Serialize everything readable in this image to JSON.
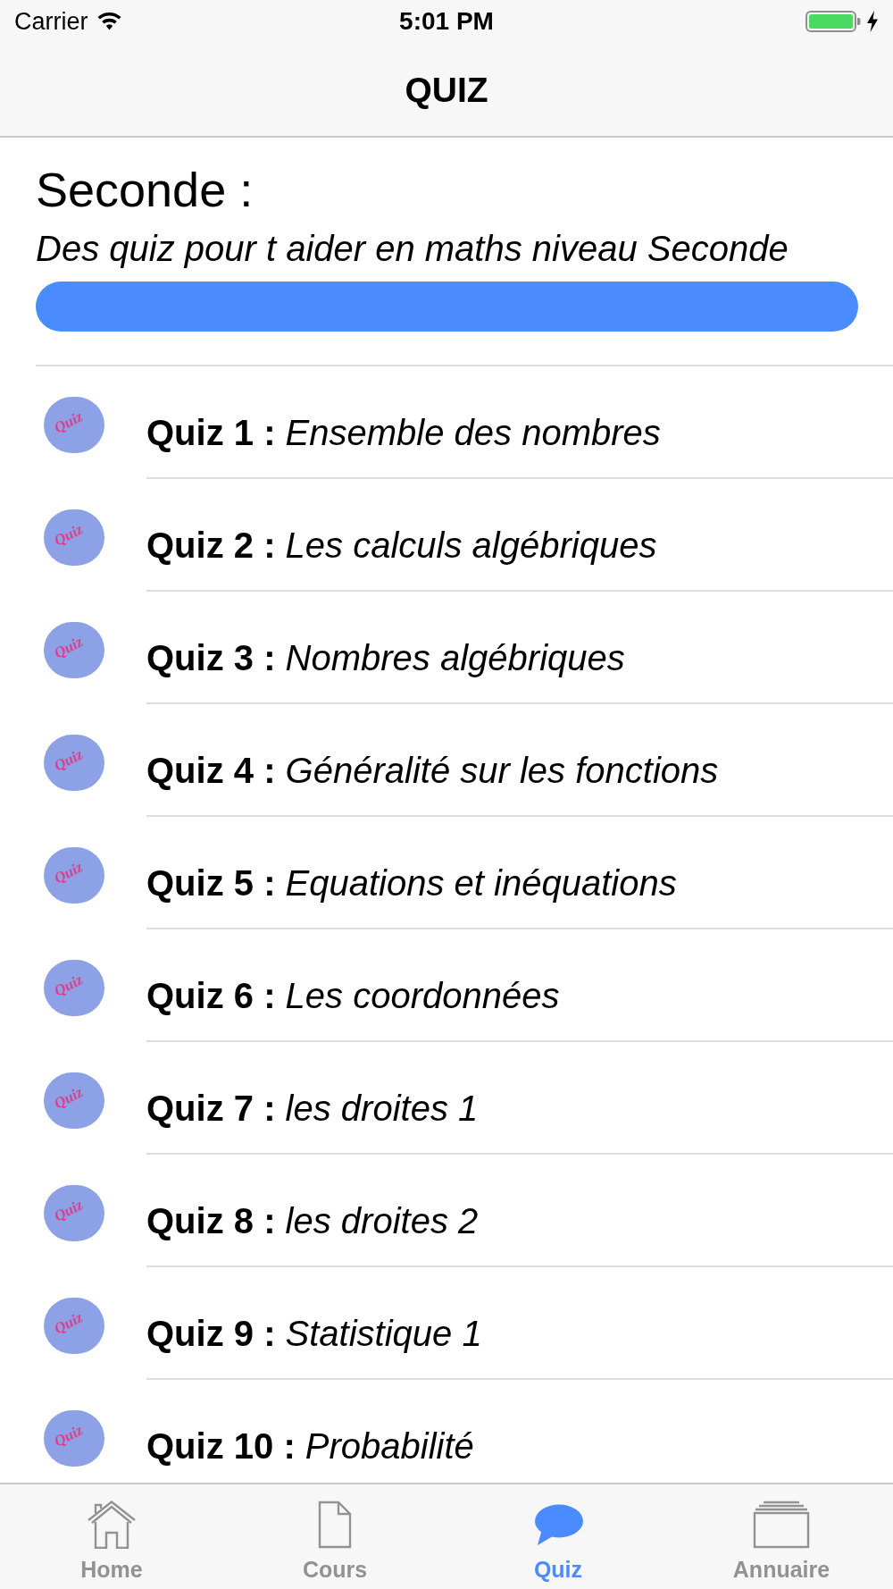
{
  "status_bar": {
    "carrier": "Carrier",
    "time": "5:01 PM"
  },
  "nav_bar": {
    "title": "QUIZ"
  },
  "header": {
    "title": "Seconde :",
    "subtitle": "Des quiz pour t aider en maths niveau Seconde"
  },
  "quizzes": [
    {
      "logo_text": "Quiz",
      "label": "Quiz 1 :",
      "topic": "Ensemble des nombres"
    },
    {
      "logo_text": "Quiz",
      "label": "Quiz 2 :",
      "topic": "Les calculs algébriques"
    },
    {
      "logo_text": "Quiz",
      "label": "Quiz 3 :",
      "topic": "Nombres algébriques"
    },
    {
      "logo_text": "Quiz",
      "label": "Quiz 4 :",
      "topic": "Généralité sur les fonctions"
    },
    {
      "logo_text": "Quiz",
      "label": "Quiz 5 :",
      "topic": "Equations et inéquations"
    },
    {
      "logo_text": "Quiz",
      "label": "Quiz 6 :",
      "topic": "Les coordonnées"
    },
    {
      "logo_text": "Quiz",
      "label": "Quiz 7 :",
      "topic": "les droites 1"
    },
    {
      "logo_text": "Quiz",
      "label": "Quiz 8 :",
      "topic": "les droites 2"
    },
    {
      "logo_text": "Quiz",
      "label": "Quiz 9 :",
      "topic": "Statistique 1"
    },
    {
      "logo_text": "Quiz",
      "label": "Quiz 10 :",
      "topic": "Probabilité"
    }
  ],
  "tab_bar": [
    {
      "label": "Home",
      "selected": false
    },
    {
      "label": "Cours",
      "selected": false
    },
    {
      "label": "Quiz",
      "selected": true
    },
    {
      "label": "Annuaire",
      "selected": false
    }
  ]
}
